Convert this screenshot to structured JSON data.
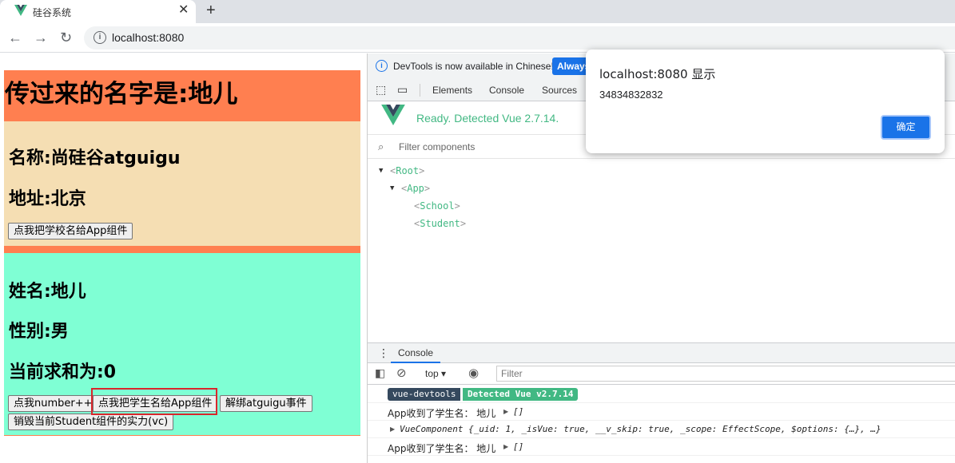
{
  "browser": {
    "tab_title": "硅谷系统",
    "tab_close": "✕",
    "new_tab": "+",
    "url": "localhost:8080"
  },
  "page": {
    "app_title": "传过来的名字是:地儿",
    "school": {
      "name": "名称:尚硅谷atguigu",
      "address": "地址:北京",
      "button": "点我把学校名给App组件"
    },
    "student": {
      "name": "姓名:地儿",
      "gender": "性别:男",
      "sum": "当前求和为:0",
      "btn_number": "点我number++",
      "btn_send_name": "点我把学生名给App组件",
      "btn_unbind": "解绑atguigu事件",
      "btn_destroy": "销毁当前Student组件的实力(vc)"
    },
    "colors": {
      "app": "#ff7f50",
      "school": "#f5deb3",
      "student": "#7fffd4"
    }
  },
  "devtools": {
    "banner": "DevTools is now available in Chinese!",
    "banner_button": "Always",
    "tabs": [
      "Elements",
      "Console",
      "Sources"
    ],
    "vue_ready": "Ready. Detected Vue 2.7.14.",
    "filter_placeholder": "Filter components",
    "tree": {
      "root": "Root",
      "app": "App",
      "school": "School",
      "student": "Student"
    },
    "console": {
      "tab": "Console",
      "context": "top",
      "filter_placeholder": "Filter",
      "devtools_tag": "vue-devtools",
      "detected_tag": "Detected Vue v2.7.14",
      "log1": "App收到了学生名：  地儿",
      "log1_arr": "[]",
      "log2": "VueComponent {_uid: 1, _isVue: true, __v_skip: true, _scope: EffectScope, $options: {…}, …}",
      "log3": "App收到了学生名：  地儿",
      "log3_arr": "[]"
    }
  },
  "alert": {
    "title": "localhost:8080 显示",
    "message": "34834832832",
    "ok": "确定"
  }
}
